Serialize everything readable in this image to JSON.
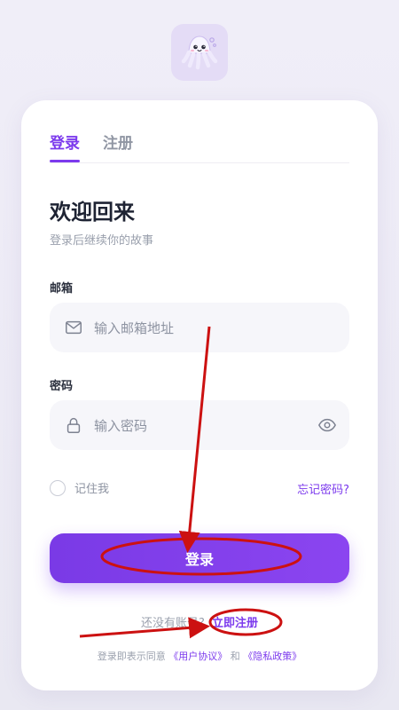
{
  "tabs": [
    {
      "label": "登录",
      "active": true
    },
    {
      "label": "注册",
      "active": false
    }
  ],
  "header": {
    "title": "欢迎回来",
    "subtitle": "登录后继续你的故事"
  },
  "form": {
    "email_label": "邮箱",
    "email_placeholder": "输入邮箱地址",
    "email_value": "",
    "password_label": "密码",
    "password_placeholder": "输入密码",
    "password_value": "",
    "remember_label": "记住我",
    "remember_checked": false,
    "forgot_label": "忘记密码?",
    "submit_label": "登录"
  },
  "footer": {
    "signup_prompt": "还没有账号?",
    "signup_link": "立即注册",
    "terms_prefix": "登录即表示同意",
    "terms_link": "《用户协议》",
    "terms_and": "和",
    "privacy_link": "《隐私政策》"
  },
  "icons": {
    "logo": "octopus-mascot-icon",
    "email": "mail-icon",
    "password": "lock-icon",
    "toggle_password": "eye-icon"
  },
  "colors": {
    "accent": "#7c3aed",
    "annotation": "#cc1111"
  }
}
